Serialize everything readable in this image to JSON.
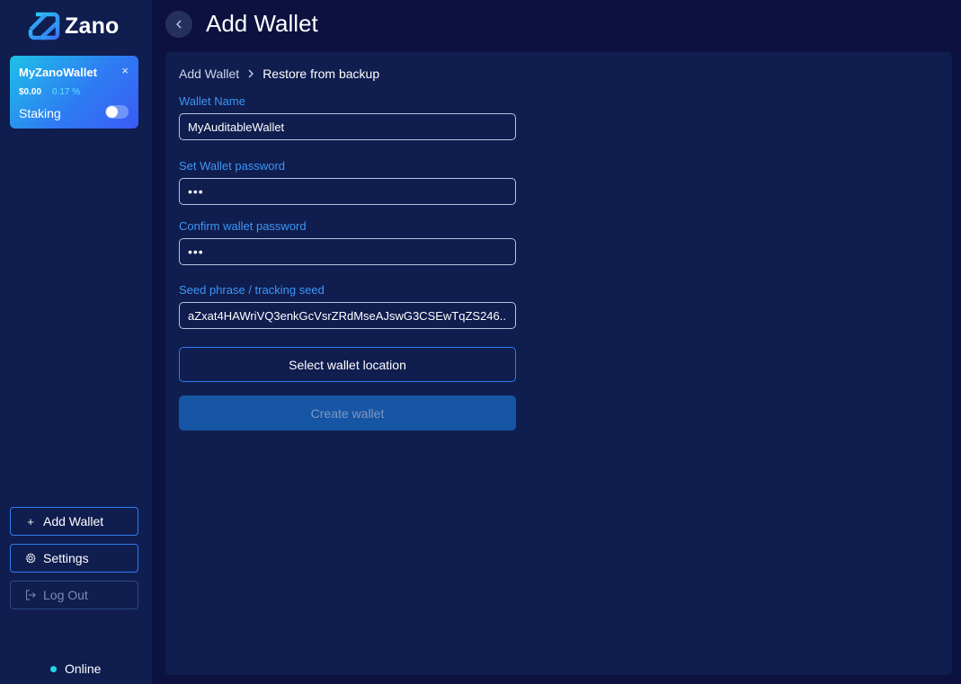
{
  "app": {
    "name": "Zano"
  },
  "sidebar": {
    "wallet": {
      "name": "MyZanoWallet",
      "close_symbol": "×",
      "balance": "$0.00",
      "change": "0.17 %",
      "staking_label": "Staking",
      "staking_on": false
    },
    "buttons": {
      "add_wallet": "Add Wallet",
      "settings": "Settings",
      "log_out": "Log Out"
    },
    "status": "Online"
  },
  "header": {
    "title": "Add Wallet"
  },
  "breadcrumb": {
    "parent": "Add Wallet",
    "current": "Restore from backup"
  },
  "form": {
    "wallet_name_label": "Wallet Name",
    "wallet_name_value": "MyAuditableWallet",
    "password_label": "Set Wallet password",
    "password_value": "•••",
    "confirm_label": "Confirm wallet password",
    "confirm_value": "•••",
    "seed_label": "Seed phrase / tracking seed",
    "seed_value": "aZxat4HAWriVQ3enkGcVsrZRdMseAJswG3CSEwTqZS246...",
    "select_location": "Select wallet location",
    "create_wallet": "Create wallet"
  },
  "colors": {
    "accent": "#3d97f5",
    "background": "#0c1140",
    "panel": "#0f1d4f",
    "online": "#27d7e3"
  }
}
